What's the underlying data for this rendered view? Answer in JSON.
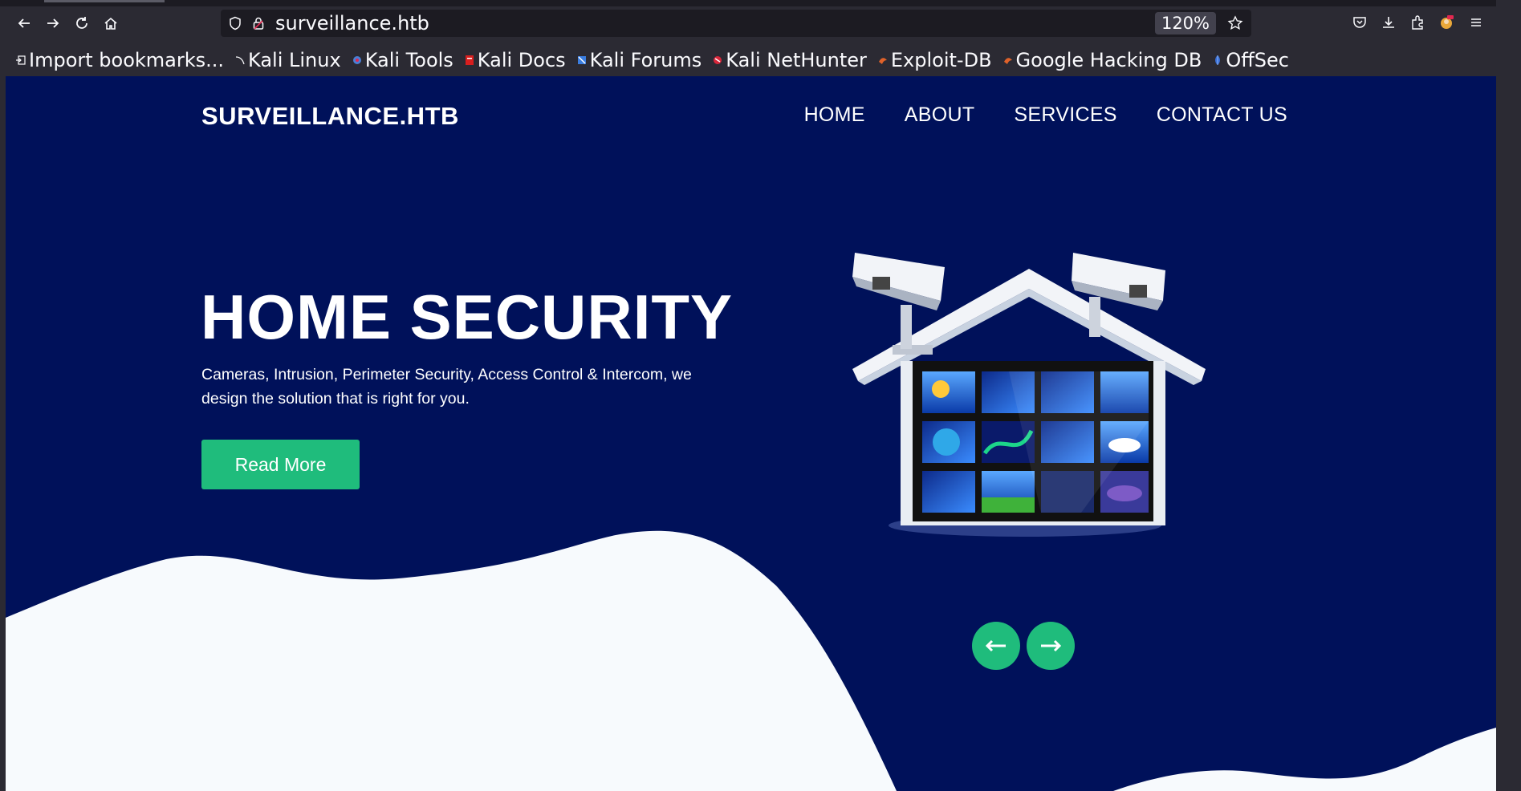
{
  "browser": {
    "url": "surveillance.htb",
    "zoom": "120%",
    "bookmarks": [
      {
        "label": "Import bookmarks...",
        "color": "#fbfbfe"
      },
      {
        "label": "Kali Linux",
        "color": "#111111"
      },
      {
        "label": "Kali Tools",
        "color": "#4a7fd6"
      },
      {
        "label": "Kali Docs",
        "color": "#d81e1e"
      },
      {
        "label": "Kali Forums",
        "color": "#3a7de0"
      },
      {
        "label": "Kali NetHunter",
        "color": "#d8263a"
      },
      {
        "label": "Exploit-DB",
        "color": "#e0622a"
      },
      {
        "label": "Google Hacking DB",
        "color": "#e0622a"
      },
      {
        "label": "OffSec",
        "color": "#3a6fd6"
      }
    ]
  },
  "site": {
    "logo": "SURVEILLANCE.HTB",
    "nav": [
      "HOME",
      "ABOUT",
      "SERVICES",
      "CONTACT US"
    ],
    "hero": {
      "title": "HOME SECURITY",
      "text": "Cameras, Intrusion, Perimeter Security, Access Control & Intercom, we design the solution that is right for you.",
      "button": "Read More"
    },
    "colors": {
      "background": "#00115a",
      "accent": "#1fbc7c",
      "wave": "#f7fafd"
    }
  }
}
